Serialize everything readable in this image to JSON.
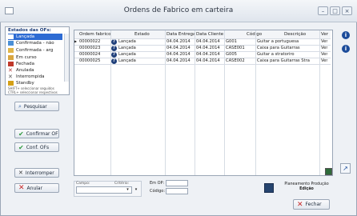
{
  "window": {
    "title": "Ordens de Fabrico em carteira",
    "minimize": "–",
    "maximize": "□",
    "close": "×"
  },
  "status_panel": {
    "heading": "Estados das OFs:",
    "items": [
      {
        "label": "Lançada",
        "selected": true,
        "color": "#2d6bd3"
      },
      {
        "label": "Confirmada - não",
        "color": "#4a8fd6"
      },
      {
        "label": "Confirmada - arg",
        "color": "#e0b64a"
      },
      {
        "label": "Em curso",
        "color": "#d9a640"
      },
      {
        "label": "Fechada",
        "color": "#c0392b"
      },
      {
        "label": "Anulada",
        "color": "#b23a3a"
      },
      {
        "label": "Interrompida",
        "color": "#5a5a5a"
      },
      {
        "label": "Standby",
        "color": "#d4a017"
      }
    ],
    "hint_line1": "SHIFT+ seleccionar seguidos",
    "hint_line2": "CTRL+ seleccionar respectivos"
  },
  "buttons": {
    "pesquisar": "Pesquisar",
    "confirmar_of": "Confirmar OF",
    "conf_ofs": "Conf. OFs",
    "interromper": "Interromper",
    "anular": "Anular",
    "planeamento_line1": "Planeamento Produção",
    "planeamento_line2": "Edição",
    "fechar": "Fechar"
  },
  "table": {
    "columns": [
      "Ordem fabrico",
      "Estado",
      "Data Entrega",
      "Data Cliente",
      "Código",
      "Descrição",
      "Ver"
    ],
    "rows": [
      {
        "ordem": "00000022",
        "estado": "Lançada",
        "entrega": "04.04.2014",
        "cliente": "04.04.2014",
        "codigo": "G001",
        "descricao": "Guitar a portuguesa",
        "ver": "Ver"
      },
      {
        "ordem": "00000023",
        "estado": "Lançada",
        "entrega": "04.04.2014",
        "cliente": "04.04.2014",
        "codigo": "CASE001",
        "descricao": "Caixa para Guitarras",
        "ver": "Ver"
      },
      {
        "ordem": "00000024",
        "estado": "Lançada",
        "entrega": "04.04.2014",
        "cliente": "04.04.2014",
        "codigo": "G005",
        "descricao": "Guitar a stratoriro",
        "ver": "Ver"
      },
      {
        "ordem": "00000025",
        "estado": "Lançada",
        "entrega": "04.04.2014",
        "cliente": "04.04.2014",
        "codigo": "CASE002",
        "descricao": "Caixa para Guitarras Stra",
        "ver": "Ver"
      }
    ]
  },
  "bottom": {
    "campo_label": "Campo:",
    "criterio_label": "Critério:",
    "em_op_label": "Em OP:",
    "codigo_label": "Código:"
  },
  "colors": {
    "accent": "#1c4c9a",
    "selected": "#2d6bd3",
    "check_green": "#2e9a3e",
    "cancel_red": "#c62828"
  }
}
